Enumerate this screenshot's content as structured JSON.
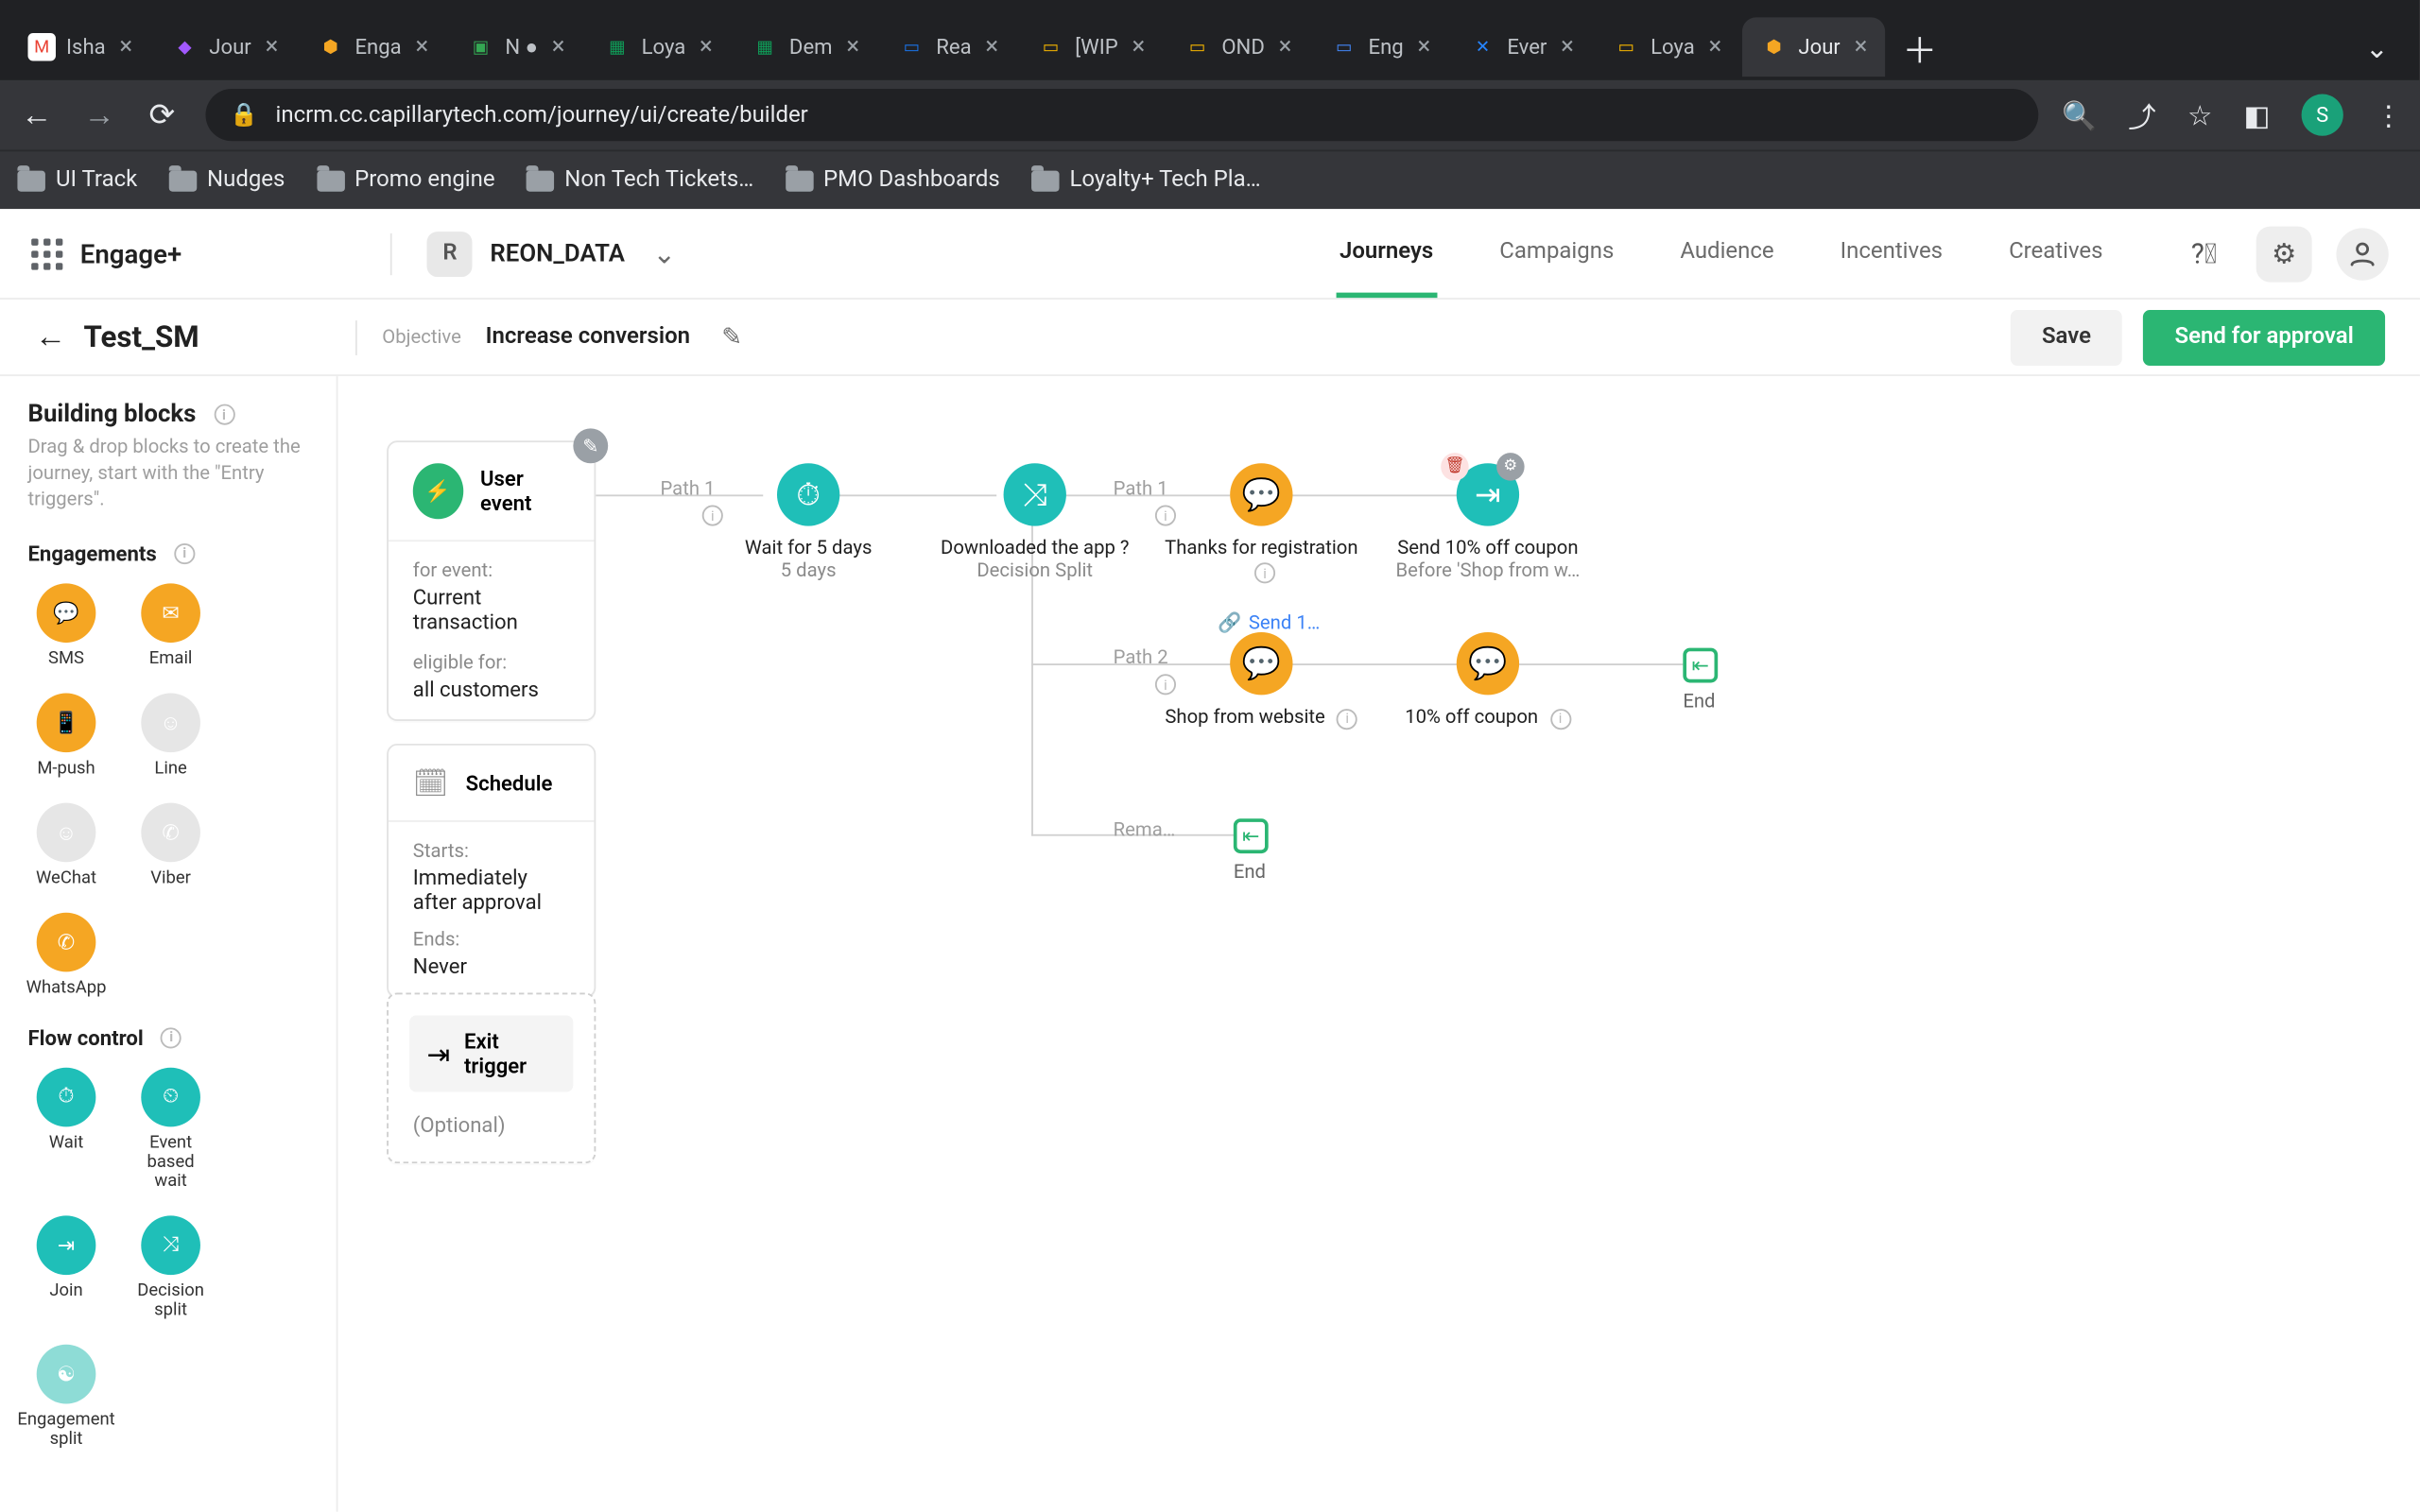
{
  "browser": {
    "tabs": [
      {
        "title": "Isha",
        "favicon": "M",
        "color": "#ea4335"
      },
      {
        "title": "Jour",
        "favicon": "F",
        "color": "#a259ff"
      },
      {
        "title": "Enga",
        "favicon": "⬢",
        "color": "#f5a623"
      },
      {
        "title": "N ●",
        "favicon": "▣",
        "color": "#34a853"
      },
      {
        "title": "Loya",
        "favicon": "▦",
        "color": "#0f9d58"
      },
      {
        "title": "Dem",
        "favicon": "▦",
        "color": "#0f9d58"
      },
      {
        "title": "Rea",
        "favicon": "▭",
        "color": "#1a73e8"
      },
      {
        "title": "[WIP",
        "favicon": "▭",
        "color": "#f4b400"
      },
      {
        "title": "OND",
        "favicon": "▭",
        "color": "#f4b400"
      },
      {
        "title": "Eng",
        "favicon": "▭",
        "color": "#4285f4"
      },
      {
        "title": "Ever",
        "favicon": "✕",
        "color": "#2684ff"
      },
      {
        "title": "Loya",
        "favicon": "▭",
        "color": "#f4b400"
      },
      {
        "title": "Jour",
        "favicon": "⬢",
        "color": "#f5a623",
        "active": true
      }
    ],
    "url": "incrm.cc.capillarytech.com/journey/ui/create/builder",
    "avatar": "S",
    "bookmarks": [
      "UI Track",
      "Nudges",
      "Promo engine",
      "Non Tech Tickets…",
      "PMO Dashboards",
      "Loyalty+ Tech Pla…"
    ]
  },
  "app": {
    "brand": "Engage+",
    "org_badge": "R",
    "org_name": "REON_DATA",
    "nav": [
      "Journeys",
      "Campaigns",
      "Audience",
      "Incentives",
      "Creatives"
    ],
    "active_nav": "Journeys"
  },
  "subheader": {
    "journey_name": "Test_SM",
    "objective_label": "Objective",
    "objective_value": "Increase conversion",
    "save": "Save",
    "approve": "Send for approval"
  },
  "sidebar": {
    "title": "Building blocks",
    "help": "Drag & drop blocks to create the journey, start with the \"Entry triggers\".",
    "sections": {
      "engagements": {
        "label": "Engagements",
        "items": [
          "SMS",
          "Email",
          "M-push",
          "Line",
          "WeChat",
          "Viber",
          "WhatsApp"
        ]
      },
      "flow": {
        "label": "Flow control",
        "items": [
          "Wait",
          "Event based wait",
          "Join",
          "Decision split",
          "Engagement split"
        ]
      }
    }
  },
  "cards": {
    "user_event": {
      "title": "User event",
      "for_event_label": "for event:",
      "for_event_value": "Current transaction",
      "eligible_label": "eligible for:",
      "eligible_value": "all customers"
    },
    "schedule": {
      "title": "Schedule",
      "starts_label": "Starts:",
      "starts_value": "Immediately after approval",
      "ends_label": "Ends:",
      "ends_value": "Never"
    },
    "exit": {
      "title": "Exit trigger",
      "optional": "(Optional)"
    }
  },
  "nodes": {
    "wait": {
      "t1": "Wait for 5 days",
      "t2": "5 days"
    },
    "decision": {
      "t1": "Downloaded the app ?",
      "t2": "Decision Split"
    },
    "thanks": {
      "t1": "Thanks for registration"
    },
    "send10": {
      "t1": "Send 10% off coupon",
      "t2": "Before 'Shop from w…"
    },
    "shop": {
      "t1": "Shop from website"
    },
    "coupon10": {
      "t1": "10% off coupon"
    },
    "linked": "Send 1…",
    "path1": "Path 1",
    "path1b": "Path 1",
    "path2": "Path 2",
    "rema": "Rema…",
    "end": "End"
  }
}
